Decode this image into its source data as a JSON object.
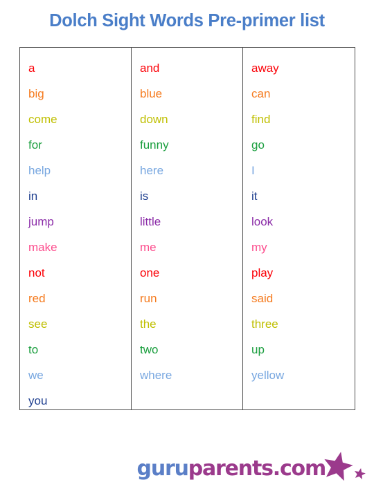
{
  "page": {
    "title": "Dolch Sight Words Pre-primer list",
    "title_color": "#4a7ec8",
    "background_color": "#ffffff"
  },
  "palette": {
    "red": "#fb0007",
    "orange": "#f57b1f",
    "yellow_green": "#bfbf00",
    "green": "#1a9e3e",
    "light_blue": "#78a7e0",
    "dark_blue": "#1f3f8f",
    "purple": "#8b2ca8",
    "pink": "#fc4d8d"
  },
  "word_table": {
    "border_color": "#4d4d4d",
    "columns": [
      {
        "name": "column-1",
        "words": [
          {
            "text": "a",
            "color": "#fb0007"
          },
          {
            "text": "big",
            "color": "#f57b1f"
          },
          {
            "text": "come",
            "color": "#bfbf00"
          },
          {
            "text": "for",
            "color": "#1a9e3e"
          },
          {
            "text": "help",
            "color": "#78a7e0"
          },
          {
            "text": "in",
            "color": "#1f3f8f"
          },
          {
            "text": "jump",
            "color": "#8b2ca8"
          },
          {
            "text": "make",
            "color": "#fc4d8d"
          },
          {
            "text": "not",
            "color": "#fb0007"
          },
          {
            "text": "red",
            "color": "#f57b1f"
          },
          {
            "text": "see",
            "color": "#bfbf00"
          },
          {
            "text": "to",
            "color": "#1a9e3e"
          },
          {
            "text": "we",
            "color": "#78a7e0"
          },
          {
            "text": "you",
            "color": "#1f3f8f"
          }
        ]
      },
      {
        "name": "column-2",
        "words": [
          {
            "text": "and",
            "color": "#fb0007"
          },
          {
            "text": "blue",
            "color": "#f57b1f"
          },
          {
            "text": "down",
            "color": "#bfbf00"
          },
          {
            "text": "funny",
            "color": "#1a9e3e"
          },
          {
            "text": "here",
            "color": "#78a7e0"
          },
          {
            "text": "is",
            "color": "#1f3f8f"
          },
          {
            "text": "little",
            "color": "#8b2ca8"
          },
          {
            "text": "me",
            "color": "#fc4d8d"
          },
          {
            "text": "one",
            "color": "#fb0007"
          },
          {
            "text": "run",
            "color": "#f57b1f"
          },
          {
            "text": "the",
            "color": "#bfbf00"
          },
          {
            "text": "two",
            "color": "#1a9e3e"
          },
          {
            "text": "where",
            "color": "#78a7e0"
          }
        ]
      },
      {
        "name": "column-3",
        "words": [
          {
            "text": "away",
            "color": "#fb0007"
          },
          {
            "text": "can",
            "color": "#f57b1f"
          },
          {
            "text": "find",
            "color": "#bfbf00"
          },
          {
            "text": "go",
            "color": "#1a9e3e"
          },
          {
            "text": "I",
            "color": "#78a7e0"
          },
          {
            "text": "it",
            "color": "#1f3f8f"
          },
          {
            "text": "look",
            "color": "#8b2ca8"
          },
          {
            "text": "my",
            "color": "#fc4d8d"
          },
          {
            "text": "play",
            "color": "#fb0007"
          },
          {
            "text": "said",
            "color": "#f57b1f"
          },
          {
            "text": "three",
            "color": "#bfbf00"
          },
          {
            "text": "up",
            "color": "#1a9e3e"
          },
          {
            "text": "yellow",
            "color": "#78a7e0"
          }
        ]
      }
    ]
  },
  "footer": {
    "logo": {
      "text_part_1": "guru",
      "text_part_2": "parents.com",
      "color_part_1": "#5b7fc7",
      "color_part_2": "#9b3a8c",
      "star_color": "#9b3a8c"
    }
  }
}
